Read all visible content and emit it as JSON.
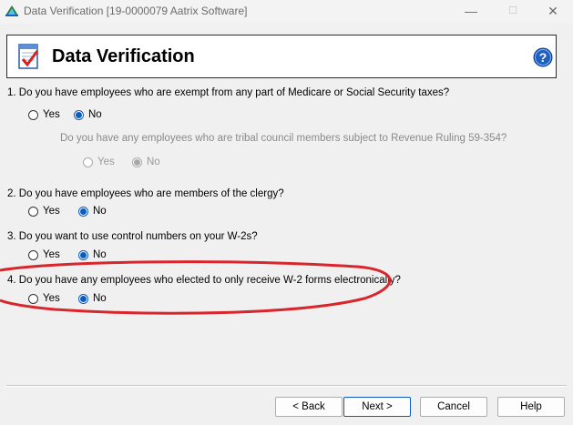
{
  "window": {
    "title": "Data Verification [19-0000079 Aatrix Software]",
    "minimize": "—",
    "maximize": "☐",
    "close": "✕"
  },
  "header": {
    "title": "Data Verification",
    "help_icon": "question-mark-icon"
  },
  "questions": [
    {
      "text": "1. Do you have employees who are exempt from any part of Medicare or Social Security taxes?",
      "yes": "Yes",
      "no": "No",
      "selected": "No",
      "sub_question": {
        "text": "Do you have any employees who are tribal council members subject to Revenue Ruling 59-354?",
        "yes": "Yes",
        "no": "No",
        "selected": "No",
        "disabled": true
      }
    },
    {
      "text": "2. Do you have employees who are members of the clergy?",
      "yes": "Yes",
      "no": "No",
      "selected": "No"
    },
    {
      "text": "3. Do you want to use control numbers on your W-2s?",
      "yes": "Yes",
      "no": "No",
      "selected": "No"
    },
    {
      "text": "4. Do you have any employees who elected to only receive W-2 forms electronically?",
      "yes": "Yes",
      "no": "No",
      "selected": "No"
    }
  ],
  "buttons": {
    "back": "< Back",
    "next": "Next >",
    "cancel": "Cancel",
    "help": "Help"
  },
  "colors": {
    "accent": "#0b5cc0",
    "annotation": "#d9262c"
  }
}
